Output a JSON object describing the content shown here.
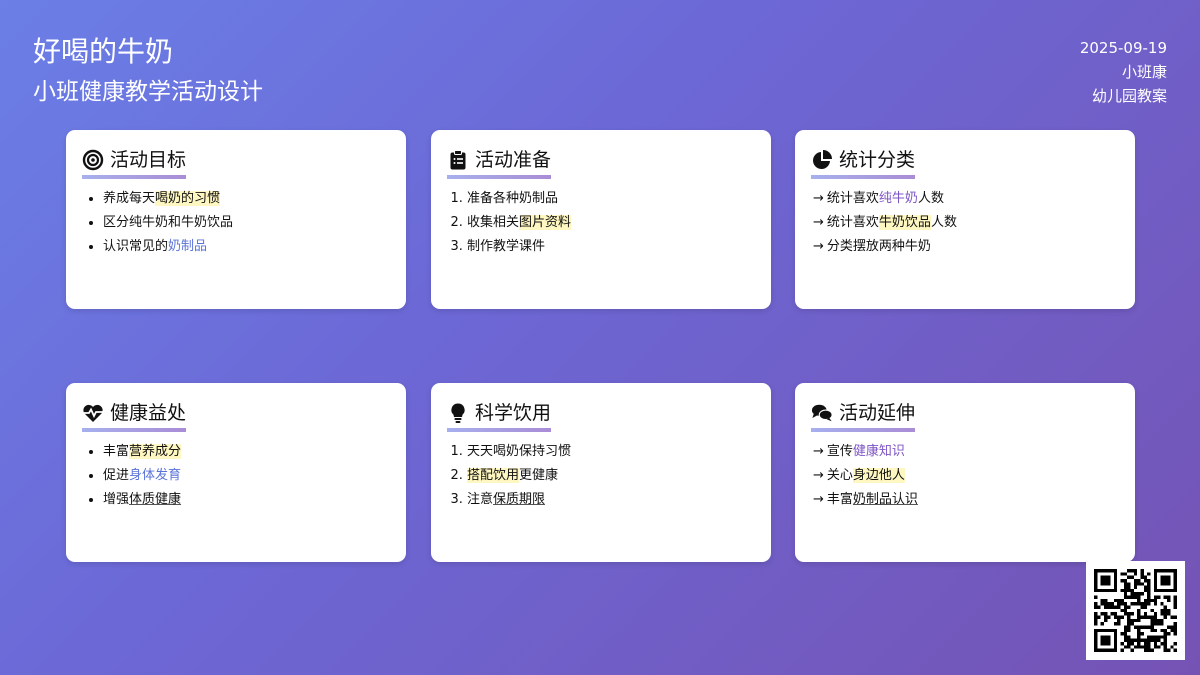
{
  "header": {
    "title": "好喝的牛奶",
    "subtitle": "小班健康教学活动设计",
    "date": "2025-09-19",
    "category": "小班康",
    "doc_type": "幼儿园教案"
  },
  "cards": [
    {
      "title": "活动目标",
      "icon": "target-icon",
      "items": [
        {
          "pre": "养成每天",
          "mark": "喝奶的习惯",
          "post": ""
        },
        {
          "pre": "区分纯牛奶和牛奶饮品",
          "mark": "",
          "post": ""
        },
        {
          "pre": "认识常见的",
          "mark": "奶制品",
          "post": ""
        }
      ]
    },
    {
      "title": "活动准备",
      "icon": "clipboard-icon",
      "items": [
        {
          "pre": "准备各种奶制品",
          "mark": "",
          "post": ""
        },
        {
          "pre": "收集相关",
          "mark": "图片资料",
          "post": ""
        },
        {
          "pre": "制作教学课件",
          "mark": "",
          "post": ""
        }
      ]
    },
    {
      "title": "统计分类",
      "icon": "pie-chart-icon",
      "arrow": "→",
      "items": [
        {
          "pre": "统计喜欢",
          "mark": "纯牛奶",
          "post": "人数"
        },
        {
          "pre": "统计喜欢",
          "mark": "牛奶饮品",
          "post": "人数"
        },
        {
          "pre": "分类摆放两种牛奶",
          "mark": "",
          "post": ""
        }
      ]
    },
    {
      "title": "健康益处",
      "icon": "heartbeat-icon",
      "items": [
        {
          "pre": "丰富",
          "mark": "营养成分",
          "post": ""
        },
        {
          "pre": "促进",
          "mark": "身体发育",
          "post": ""
        },
        {
          "pre": "增强",
          "mark": "体质健康",
          "post": ""
        }
      ]
    },
    {
      "title": "科学饮用",
      "icon": "lightbulb-icon",
      "items": [
        {
          "pre": "天天喝奶保持习惯",
          "mark": "",
          "post": ""
        },
        {
          "pre": "",
          "mark": "搭配饮用",
          "post": "更健康"
        },
        {
          "pre": "注意",
          "mark": "保质期限",
          "post": ""
        }
      ]
    },
    {
      "title": "活动延伸",
      "icon": "comments-icon",
      "arrow": "→",
      "items": [
        {
          "pre": "宣传",
          "mark": "健康知识",
          "post": ""
        },
        {
          "pre": "关心",
          "mark": "身边他人",
          "post": ""
        },
        {
          "pre": "丰富",
          "mark": "奶制品认识",
          "post": ""
        }
      ]
    }
  ],
  "colors": {
    "background_start": "#6b7fe6",
    "background_end": "#7553b4",
    "highlight": "#fff7c2",
    "accent_blue": "#5a73d8",
    "accent_purple": "#7d55c4"
  },
  "qr_code": "qr-code-icon"
}
